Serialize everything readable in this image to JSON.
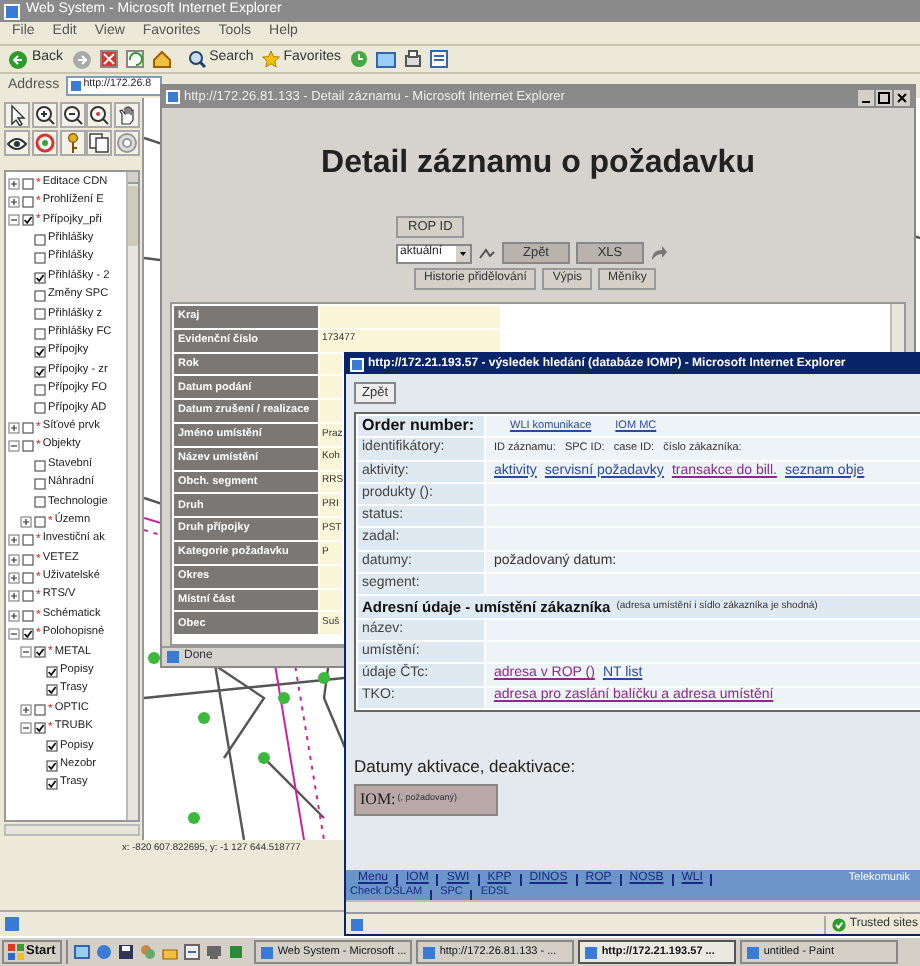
{
  "main_window": {
    "title": "Web System - Microsoft Internet Explorer",
    "menu": [
      "File",
      "Edit",
      "View",
      "Favorites",
      "Tools",
      "Help"
    ],
    "toolbar": [
      "Back",
      "Search",
      "Favorites"
    ],
    "address_label": "Address",
    "address": "http://172.26.8"
  },
  "layer_tree": [
    {
      "label": "Editace CDN",
      "flag": "*",
      "checked": false,
      "expanded": false
    },
    {
      "label": "Prohlížení E",
      "flag": "*",
      "checked": false,
      "expanded": false
    },
    {
      "label": "Přípojky_při",
      "flag": "*",
      "checked": true,
      "expanded": true,
      "children": [
        {
          "label": "Přihlášky",
          "checked": false
        },
        {
          "label": "Přihlášky",
          "checked": false
        },
        {
          "label": "Přihlášky - 2",
          "checked": true
        },
        {
          "label": "Změny SPC",
          "checked": false
        },
        {
          "label": "Přihlášky z",
          "checked": false
        },
        {
          "label": "Přihlášky FC",
          "checked": false
        },
        {
          "label": "Přípojky",
          "checked": true
        },
        {
          "label": "Přípojky - zr",
          "checked": true
        },
        {
          "label": "Přípojky FO",
          "checked": false
        },
        {
          "label": "Přípojky AD",
          "checked": false
        }
      ]
    },
    {
      "label": "Síťové prvk",
      "flag": "*",
      "checked": false,
      "expanded": false
    },
    {
      "label": "Objekty",
      "flag": "*",
      "checked": false,
      "expanded": true,
      "children": [
        {
          "label": "Stavební",
          "checked": false
        },
        {
          "label": "Náhradní",
          "checked": false
        },
        {
          "label": "Technologie",
          "checked": false
        },
        {
          "label": "Územn",
          "flag": "*",
          "checked": false,
          "expanded": false
        }
      ]
    },
    {
      "label": "Investiční ak",
      "flag": "*",
      "checked": false,
      "expanded": false
    },
    {
      "label": "VETEZ",
      "flag": "*",
      "checked": false,
      "expanded": false
    },
    {
      "label": "Uživatelské",
      "flag": "*",
      "checked": false,
      "expanded": false
    },
    {
      "label": "RTS/V",
      "flag": "*",
      "checked": false,
      "expanded": false
    },
    {
      "label": "Schématick",
      "flag": "*",
      "checked": false,
      "expanded": false
    },
    {
      "label": "Polohopisné",
      "flag": "*",
      "checked": true,
      "expanded": true,
      "children": [
        {
          "label": "METAL",
          "flag": "*",
          "checked": true,
          "expanded": true,
          "children": [
            {
              "label": "Popisy",
              "checked": true
            },
            {
              "label": "Trasy",
              "checked": true
            }
          ]
        },
        {
          "label": "OPTIC",
          "flag": "*",
          "checked": false,
          "expanded": false
        },
        {
          "label": "TRUBK",
          "flag": "*",
          "checked": true,
          "expanded": true,
          "children": [
            {
              "label": "Popisy",
              "checked": true
            },
            {
              "label": "Nezobr",
              "checked": true
            },
            {
              "label": "Trasy",
              "checked": true
            }
          ]
        }
      ]
    }
  ],
  "map": {
    "coordinates": "x: -820 607.822695, y: -1 127 644.518777"
  },
  "detail_window": {
    "title": "http://172.26.81.133 - Detail záznamu - Microsoft Internet Explorer",
    "heading": "Detail záznamu o požadavku",
    "rop_button": "ROP ID",
    "select_value": "aktuální",
    "buttons": [
      "Zpět",
      "XLS"
    ],
    "buttons_row2": [
      "Historie přidělování",
      "Výpis",
      "Měníky"
    ],
    "rows": [
      {
        "label": "Kraj",
        "value": ""
      },
      {
        "label": "Evidenční číslo",
        "value": "173477"
      },
      {
        "label": "Rok",
        "value": ""
      },
      {
        "label": "Datum podání",
        "value": ""
      },
      {
        "label": "Datum zrušení / realizace",
        "value": ""
      },
      {
        "label": "Jméno umístění",
        "value": "Praz"
      },
      {
        "label": "Název umístění",
        "value": "Koh"
      },
      {
        "label": "Obch. segment",
        "value": "RRS"
      },
      {
        "label": "Druh",
        "value": "PRI"
      },
      {
        "label": "Druh přípojky",
        "value": "PST"
      },
      {
        "label": "Kategorie požadavku",
        "value": "P"
      },
      {
        "label": "Okres",
        "value": ""
      },
      {
        "label": "Místní část",
        "value": ""
      },
      {
        "label": "Obec",
        "value": "Suš"
      }
    ],
    "status": "Done"
  },
  "result_window": {
    "title": "http://172.21.193.57 - výsledek hledání (databáze IOMP) - Microsoft Internet Explorer",
    "back_button": "Zpět",
    "rows": [
      {
        "kind": "header",
        "label": "Order number:",
        "links": [
          {
            "label": "WLI komunikace",
            "visited": false
          },
          {
            "label": "IOM MC",
            "visited": false
          }
        ]
      },
      {
        "kind": "field",
        "label": "identifikátory:",
        "value": "ID záznamu:   SPC ID:   case ID:   číslo zákazníka:"
      },
      {
        "kind": "field",
        "label": "aktivity:",
        "links": [
          {
            "label": "aktivity",
            "visited": false
          },
          {
            "label": "servisní požadavky",
            "visited": false
          },
          {
            "label": "transakce do bill.",
            "visited": true
          },
          {
            "label": "seznam obje",
            "visited": false
          }
        ]
      },
      {
        "kind": "field",
        "label": "produkty ():"
      },
      {
        "kind": "field",
        "label": "status:"
      },
      {
        "kind": "field",
        "label": "zadal:"
      },
      {
        "kind": "field",
        "label": "datumy:",
        "value": "požadovaný datum:"
      },
      {
        "kind": "field",
        "label": "segment:"
      },
      {
        "kind": "section",
        "label": "Adresní údaje - umístění zákazníka",
        "note": "(adresa umístění i sídlo zákazníka je shodná)"
      },
      {
        "kind": "field",
        "label": "název:"
      },
      {
        "kind": "field",
        "label": "umístění:"
      },
      {
        "kind": "field",
        "label": "údaje ČTc:",
        "links": [
          {
            "label": "adresa v ROP ()",
            "visited": true
          },
          {
            "label": "NT list",
            "visited": false
          }
        ]
      },
      {
        "kind": "field",
        "label": "TKO:",
        "links": [
          {
            "label": "adresa pro zaslání balíčku a adresa umístění",
            "visited": true
          }
        ]
      }
    ],
    "dates_heading": "Datumy aktivace, deaktivace:",
    "iom_label": "IOM:",
    "iom_note": "(, požadovaný)",
    "footer_links": [
      "Menu",
      "IOM",
      "SWI",
      "KPP",
      "DINOS",
      "ROP",
      "NOSB",
      "WLI"
    ],
    "footer_brand": "Telekomunik",
    "footer_links_row2": [
      "Check DSLAM",
      "SPC",
      "EDSL"
    ],
    "zone": "Trusted sites"
  },
  "taskbar": {
    "start": "Start",
    "tasks": [
      {
        "label": "Web System - Microsoft ...",
        "selected": false
      },
      {
        "label": "http://172.26.81.133 - ...",
        "selected": false
      },
      {
        "label": "http://172.21.193.57 ...",
        "selected": true
      },
      {
        "label": "untitled - Paint",
        "selected": false
      }
    ]
  }
}
